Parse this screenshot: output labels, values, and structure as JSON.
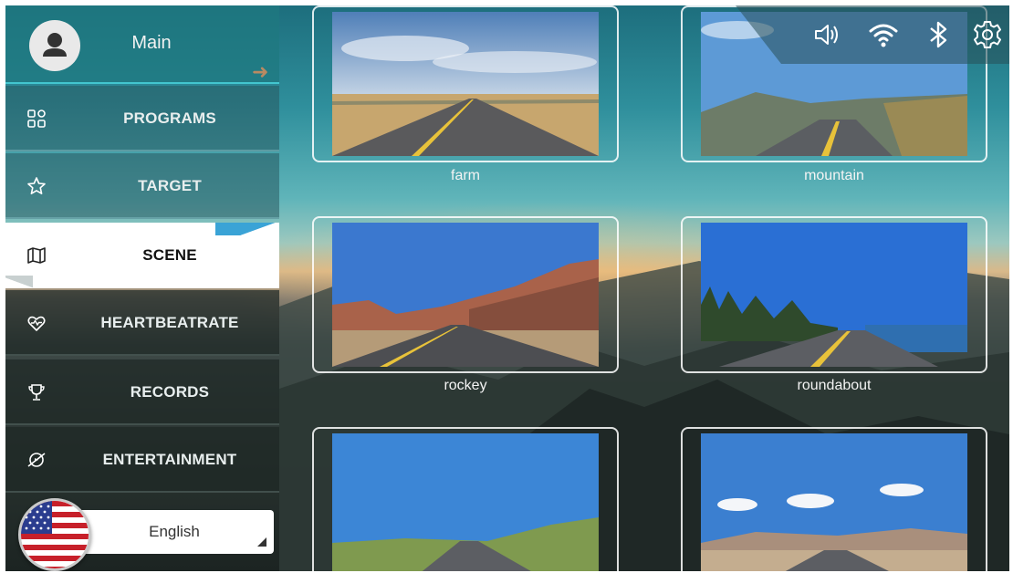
{
  "user": {
    "name": "Main",
    "avatar_icon": "person-icon",
    "go_icon": "arrow-right-icon"
  },
  "nav": {
    "items": [
      {
        "key": "programs",
        "label": "PROGRAMS",
        "icon": "grid-icon",
        "active": false
      },
      {
        "key": "target",
        "label": "TARGET",
        "icon": "star-icon",
        "active": false
      },
      {
        "key": "scene",
        "label": "SCENE",
        "icon": "map-icon",
        "active": true
      },
      {
        "key": "heartbeatrate",
        "label": "HEARTBEATRATE",
        "icon": "heart-icon",
        "active": false
      },
      {
        "key": "records",
        "label": "RECORDS",
        "icon": "trophy-icon",
        "active": false
      },
      {
        "key": "entertainment",
        "label": "ENTERTAINMENT",
        "icon": "entertainment-icon",
        "active": false
      }
    ]
  },
  "language": {
    "selected": "English",
    "flag": "us-flag-icon"
  },
  "scenes": [
    {
      "label": "farm"
    },
    {
      "label": "mountain"
    },
    {
      "label": "rockey"
    },
    {
      "label": "roundabout"
    },
    {
      "label": ""
    },
    {
      "label": ""
    }
  ],
  "status_bar": {
    "icons": [
      "volume-icon",
      "wifi-icon",
      "bluetooth-icon",
      "settings-gear-icon"
    ]
  },
  "colors": {
    "accent": "#43c6cf",
    "active_corner": "#3aa3d6",
    "active_bg": "#ffffff"
  }
}
